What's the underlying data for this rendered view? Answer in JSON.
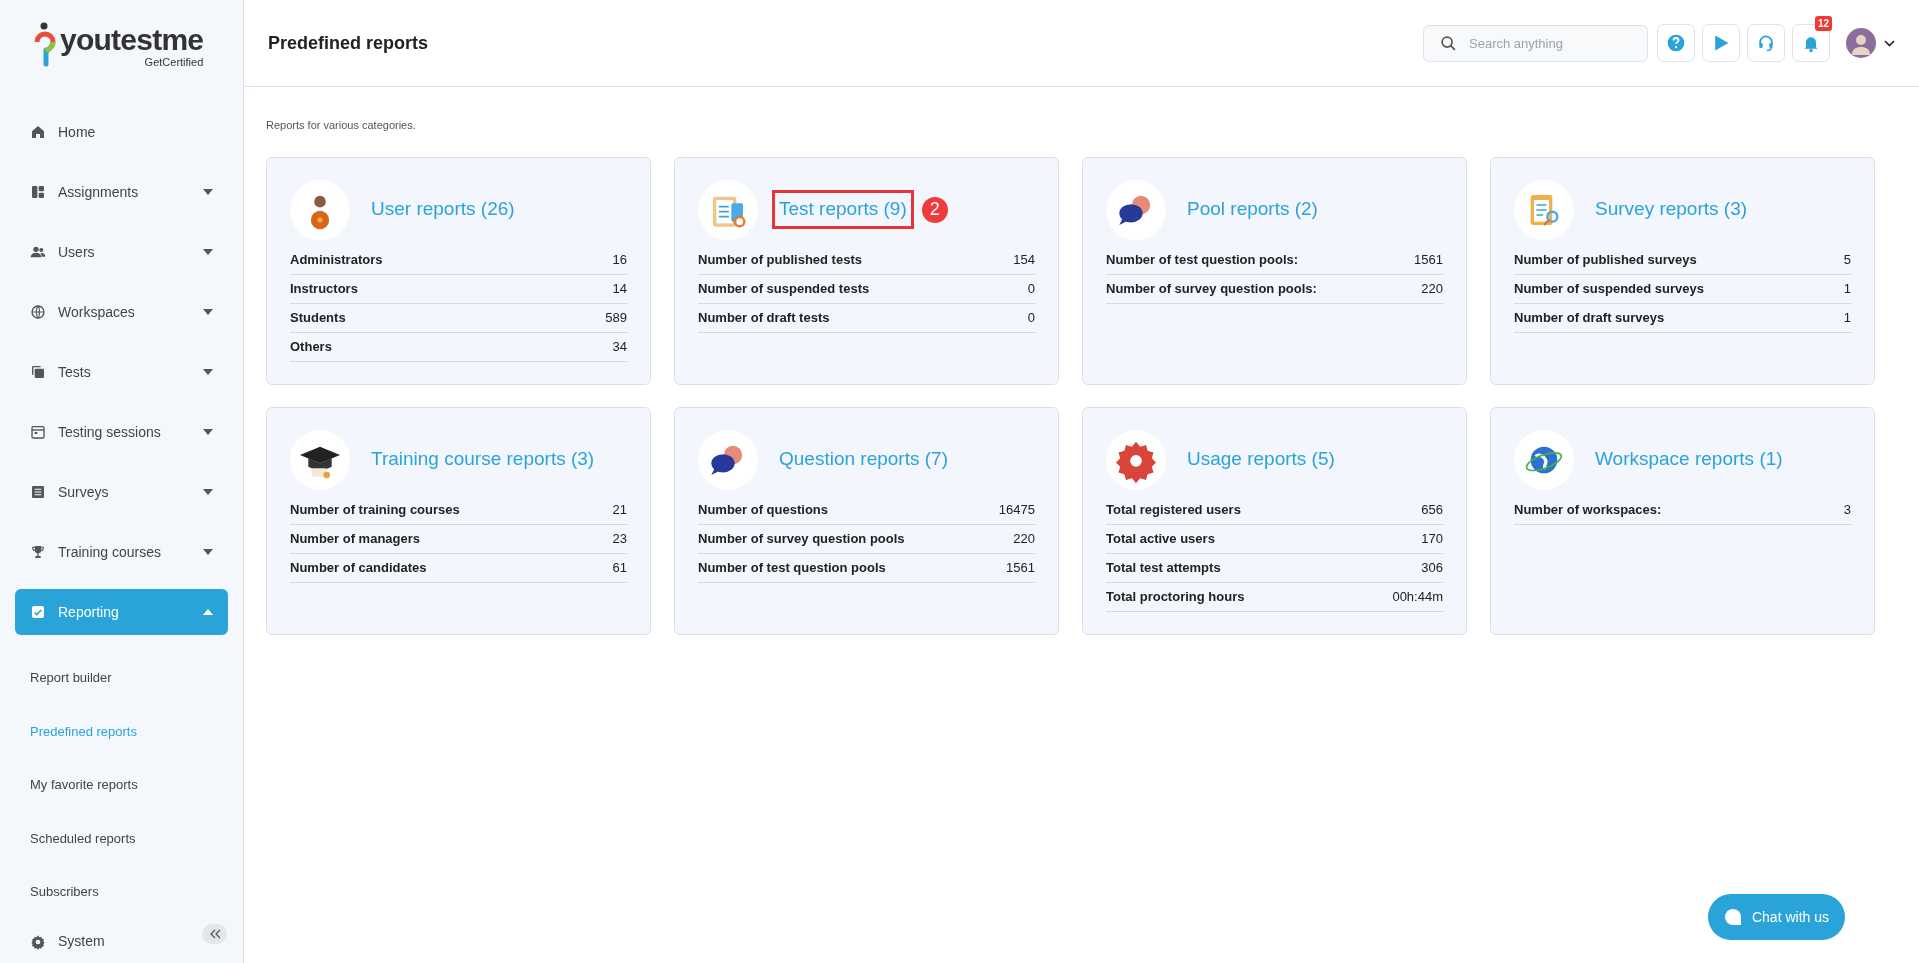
{
  "logo": {
    "name": "youtestme",
    "tagline": "GetCertified"
  },
  "sidebar": {
    "items": [
      {
        "label": "Home",
        "selected": false
      },
      {
        "label": "Assignments",
        "selected": false,
        "expanded": false
      },
      {
        "label": "Users",
        "selected": false,
        "expanded": false
      },
      {
        "label": "Workspaces",
        "selected": false,
        "expanded": false
      },
      {
        "label": "Tests",
        "selected": false,
        "expanded": false
      },
      {
        "label": "Testing sessions",
        "selected": false,
        "expanded": false
      },
      {
        "label": "Surveys",
        "selected": false,
        "expanded": false
      },
      {
        "label": "Training courses",
        "selected": false,
        "expanded": false
      },
      {
        "label": "Reporting",
        "selected": true,
        "expanded": true,
        "children": [
          {
            "label": "Report builder",
            "selected": false
          },
          {
            "label": "Predefined reports",
            "selected": true
          },
          {
            "label": "My favorite reports",
            "selected": false
          },
          {
            "label": "Scheduled reports",
            "selected": false
          },
          {
            "label": "Subscribers",
            "selected": false
          }
        ]
      },
      {
        "label": "System",
        "selected": false
      }
    ]
  },
  "header": {
    "title": "Predefined reports",
    "search": {
      "placeholder": "Search anything"
    },
    "notifications": "12"
  },
  "subtitle": "Reports for various categories.",
  "cards": [
    {
      "title": "User reports (26)",
      "highlighted": false,
      "rows": [
        {
          "label": "Administrators",
          "value": "16"
        },
        {
          "label": "Instructors",
          "value": "14"
        },
        {
          "label": "Students",
          "value": "589"
        },
        {
          "label": "Others",
          "value": "34"
        }
      ]
    },
    {
      "title": "Test reports (9)",
      "highlighted": true,
      "callout": "2",
      "rows": [
        {
          "label": "Number of published tests",
          "value": "154"
        },
        {
          "label": "Number of suspended tests",
          "value": "0"
        },
        {
          "label": "Number of draft tests",
          "value": "0"
        }
      ]
    },
    {
      "title": "Pool reports (2)",
      "highlighted": false,
      "rows": [
        {
          "label": "Number of test question pools:",
          "value": "1561"
        },
        {
          "label": "Number of survey question pools:",
          "value": "220"
        }
      ]
    },
    {
      "title": "Survey reports (3)",
      "highlighted": false,
      "rows": [
        {
          "label": "Number of published surveys",
          "value": "5"
        },
        {
          "label": "Number of suspended surveys",
          "value": "1"
        },
        {
          "label": "Number of draft surveys",
          "value": "1"
        }
      ]
    },
    {
      "title": "Training course reports (3)",
      "highlighted": false,
      "rows": [
        {
          "label": "Number of training courses",
          "value": "21"
        },
        {
          "label": "Number of managers",
          "value": "23"
        },
        {
          "label": "Number of candidates",
          "value": "61"
        }
      ]
    },
    {
      "title": "Question reports (7)",
      "highlighted": false,
      "rows": [
        {
          "label": "Number of questions",
          "value": "16475"
        },
        {
          "label": "Number of survey question pools",
          "value": "220"
        },
        {
          "label": "Number of test question pools",
          "value": "1561"
        }
      ]
    },
    {
      "title": "Usage reports (5)",
      "highlighted": false,
      "rows": [
        {
          "label": "Total registered users",
          "value": "656"
        },
        {
          "label": "Total active users",
          "value": "170"
        },
        {
          "label": "Total test attempts",
          "value": "306"
        },
        {
          "label": "Total proctoring hours",
          "value": "00h:44m"
        }
      ]
    },
    {
      "title": "Workspace reports (1)",
      "highlighted": false,
      "rows": [
        {
          "label": "Number of workspaces:",
          "value": "3"
        }
      ]
    }
  ],
  "chat_button": "Chat with us"
}
